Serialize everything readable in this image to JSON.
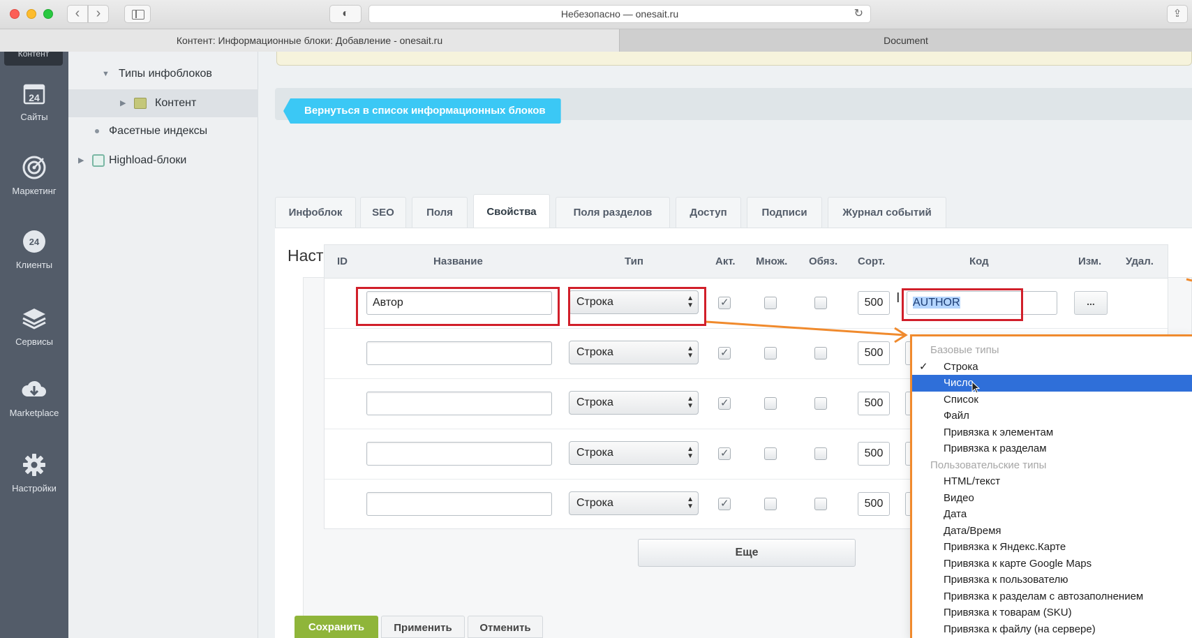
{
  "browser": {
    "url_text": "Небезопасно — onesait.ru",
    "privacy_icon": "privacy-icon",
    "tabs": [
      {
        "title": "Контент: Информационные блоки: Добавление - onesait.ru"
      },
      {
        "title": "Document"
      }
    ]
  },
  "rail": {
    "top_label": "Контент",
    "items": [
      {
        "label": "Сайты",
        "icon": "calendar-24-icon"
      },
      {
        "label": "Маркетинг",
        "icon": "target-icon"
      },
      {
        "label": "Клиенты",
        "icon": "crm-24-icon"
      },
      {
        "label": "Сервисы",
        "icon": "layers-icon"
      },
      {
        "label": "Marketplace",
        "icon": "cloud-download-icon"
      },
      {
        "label": "Настройки",
        "icon": "gear-icon"
      }
    ]
  },
  "tree": {
    "items": [
      {
        "label": "Типы инфоблоков"
      },
      {
        "label": "Контент"
      },
      {
        "label": "Фасетные индексы"
      },
      {
        "label": "Highload-блоки"
      }
    ]
  },
  "back_button": "Вернуться в список информационных блоков",
  "tabs": [
    {
      "label": "Инфоблок"
    },
    {
      "label": "SEO"
    },
    {
      "label": "Поля"
    },
    {
      "label": "Свойства"
    },
    {
      "label": "Поля разделов"
    },
    {
      "label": "Доступ"
    },
    {
      "label": "Подписи"
    },
    {
      "label": "Журнал событий"
    }
  ],
  "active_tab": "Свойства",
  "panel_title": "Настройка свойств элементов",
  "table": {
    "columns": [
      "ID",
      "Название",
      "Тип",
      "Акт.",
      "Множ.",
      "Обяз.",
      "Сорт.",
      "Код",
      "Изм.",
      "Удал."
    ],
    "rows": [
      {
        "name": "Автор",
        "type": "Строка",
        "active": true,
        "multiple": false,
        "required": false,
        "sort": "500",
        "code": "AUTHOR",
        "edit": "..."
      },
      {
        "name": "",
        "type": "Строка",
        "active": true,
        "multiple": false,
        "required": false,
        "sort": "500",
        "code": ""
      },
      {
        "name": "",
        "type": "Строка",
        "active": true,
        "multiple": false,
        "required": false,
        "sort": "500",
        "code": ""
      },
      {
        "name": "",
        "type": "Строка",
        "active": true,
        "multiple": false,
        "required": false,
        "sort": "500",
        "code": ""
      },
      {
        "name": "",
        "type": "Строка",
        "active": true,
        "multiple": false,
        "required": false,
        "sort": "500",
        "code": ""
      }
    ]
  },
  "more_button": "Еще",
  "footer": {
    "save": "Сохранить",
    "apply": "Применить",
    "cancel": "Отменить"
  },
  "type_dropdown": {
    "items": [
      {
        "label": "Базовые типы",
        "group": true
      },
      {
        "label": "Строка",
        "checked": true
      },
      {
        "label": "Число",
        "highlighted": true
      },
      {
        "label": "Список"
      },
      {
        "label": "Файл"
      },
      {
        "label": "Привязка к элементам"
      },
      {
        "label": "Привязка к разделам"
      },
      {
        "label": "Пользовательские типы",
        "group": true
      },
      {
        "label": "HTML/текст"
      },
      {
        "label": "Видео"
      },
      {
        "label": "Дата"
      },
      {
        "label": "Дата/Время"
      },
      {
        "label": "Привязка к Яндекс.Карте"
      },
      {
        "label": "Привязка к карте Google Maps"
      },
      {
        "label": "Привязка к пользователю"
      },
      {
        "label": "Привязка к разделам с автозаполнением"
      },
      {
        "label": "Привязка к товарам (SKU)"
      },
      {
        "label": "Привязка к файлу (на сервере)"
      }
    ]
  },
  "colors": {
    "annotation_red": "#d11f2a",
    "annotation_orange": "#f08a2d",
    "back_button": "#3bc8f5",
    "save_button": "#8fb53a",
    "dropdown_highlight": "#2f6fd9"
  }
}
